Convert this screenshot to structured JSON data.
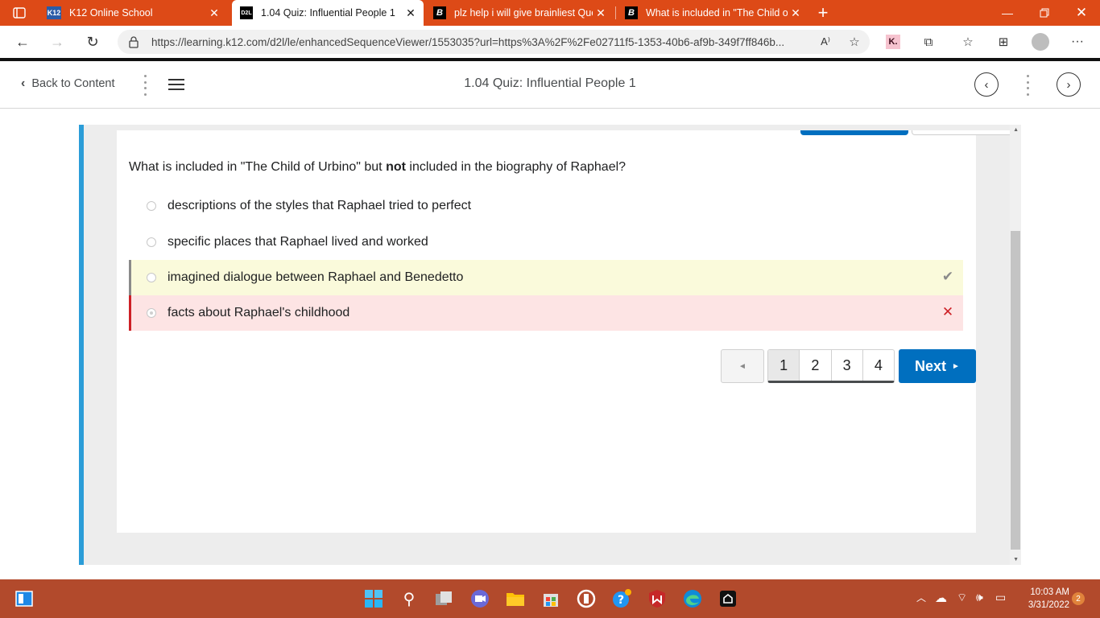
{
  "browser": {
    "tabs": [
      {
        "label": "K12 Online School",
        "favicon": "K12"
      },
      {
        "label": "1.04 Quiz: Influential People 1",
        "favicon": "D2L"
      },
      {
        "label": "plz help i will give brainliest Que",
        "favicon": "B"
      },
      {
        "label": "What is included in \"The Child of",
        "favicon": "B"
      }
    ],
    "new_tab": "+",
    "url": "https://learning.k12.com/d2l/le/enhancedSequenceViewer/1553035?url=https%3A%2F%2Fe02711f5-1353-40b6-af9b-349f7ff846b...",
    "extension_badge": "K."
  },
  "nav": {
    "back_label": "Back to Content",
    "title": "1.04 Quiz: Influential People 1"
  },
  "quiz": {
    "question_pre": "What is included in \"The Child of Urbino\" but ",
    "question_emph": "not",
    "question_post": " included in the biography of Raphael?",
    "options": [
      {
        "text": "descriptions of the styles that Raphael tried to perfect",
        "state": "none"
      },
      {
        "text": "specific places that Raphael lived and worked",
        "state": "none"
      },
      {
        "text": "imagined dialogue between Raphael and Benedetto",
        "state": "correct"
      },
      {
        "text": "facts about Raphael's childhood",
        "state": "selected-wrong"
      }
    ],
    "correct_color": "#fafadb",
    "wrong_color": "#fde4e4"
  },
  "pager": {
    "prev_symbol": "◄",
    "pages": [
      "1",
      "2",
      "3",
      "4"
    ],
    "current_page": "1",
    "next_label": "Next",
    "next_symbol": "►"
  },
  "taskbar": {
    "time": "10:03 AM",
    "date": "3/31/2022",
    "notifications": "2"
  },
  "colors": {
    "tabstrip": "#dd4a17",
    "taskbar": "#b24a2c",
    "accent_blue": "#006fbf",
    "viewer_edge": "#2b9dd8"
  }
}
